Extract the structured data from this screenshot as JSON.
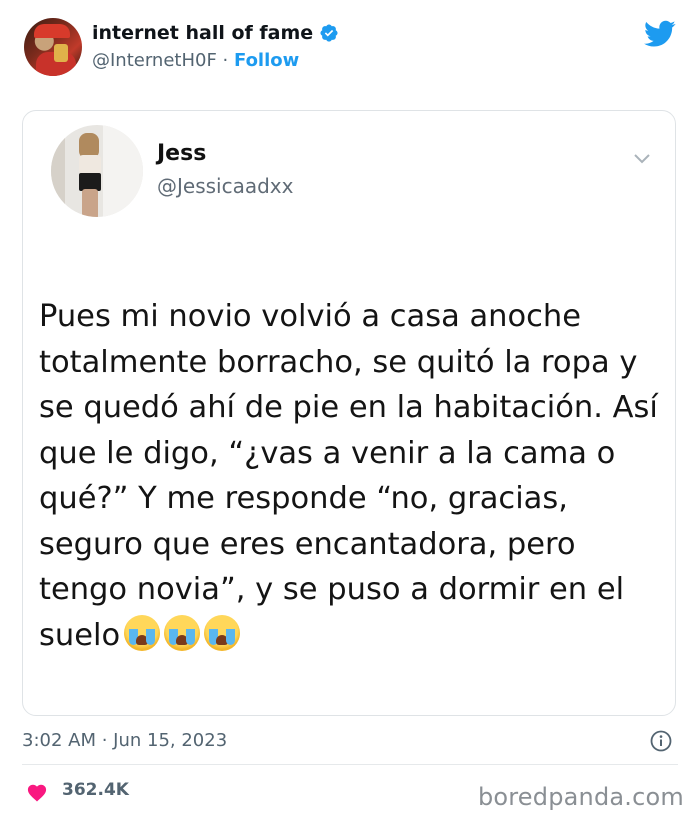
{
  "author": {
    "display_name": "internet hall of fame",
    "handle": "@InternetH0F",
    "separator": " · ",
    "follow_label": "Follow"
  },
  "quoted": {
    "display_name": "Jess",
    "handle": "@Jessicaadxx",
    "text": "Pues mi novio volvió a casa anoche totalmente borracho, se quitó la ropa y se quedó ahí de pie en la habitación. Así que le digo, “¿vas a venir a la cama o qué?” Y me responde “no, gracias, seguro que eres encantadora, pero tengo novia”, y se puso a dormir en el suelo"
  },
  "meta": {
    "timestamp": "3:02 AM · Jun 15, 2023"
  },
  "stats": {
    "likes": "362.4K"
  },
  "credit": "boredpanda.com",
  "colors": {
    "twitter_blue": "#1d9bf0",
    "like_pink": "#f91880",
    "muted": "#536471"
  },
  "icons": [
    "verified-badge-icon",
    "twitter-bird-icon",
    "chevron-down-icon",
    "info-icon",
    "heart-icon",
    "loudly-crying-face-emoji"
  ]
}
